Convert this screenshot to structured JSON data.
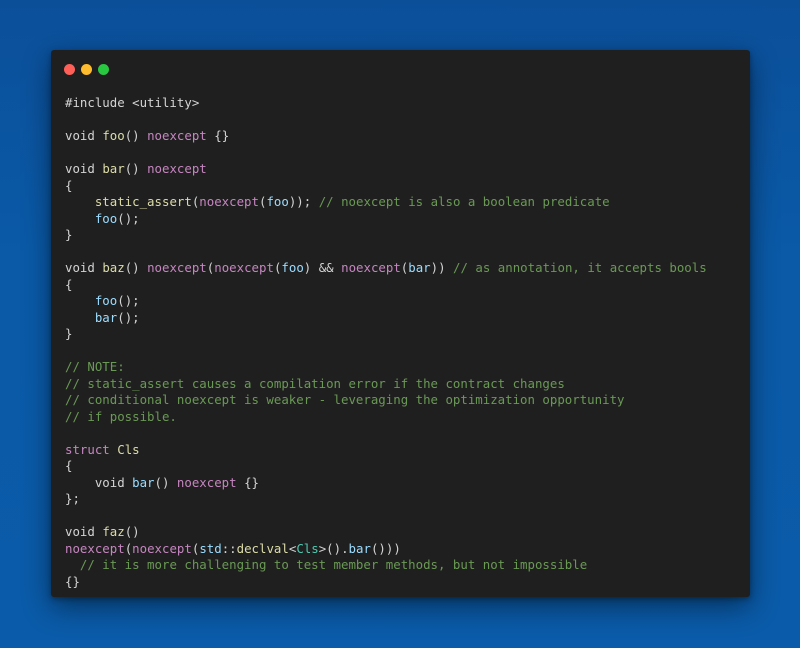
{
  "window": {
    "controls": [
      {
        "name": "close",
        "color": "#ff5f57"
      },
      {
        "name": "minimize",
        "color": "#febc2e"
      },
      {
        "name": "maximize",
        "color": "#28c840"
      }
    ]
  },
  "code_lines": [
    [
      {
        "t": "txt",
        "v": "#include <utility>"
      }
    ],
    [],
    [
      {
        "t": "txt",
        "v": "void "
      },
      {
        "t": "fn",
        "v": "foo"
      },
      {
        "t": "txt",
        "v": "() "
      },
      {
        "t": "kw",
        "v": "noexcept"
      },
      {
        "t": "txt",
        "v": " {}"
      }
    ],
    [],
    [
      {
        "t": "txt",
        "v": "void "
      },
      {
        "t": "fn",
        "v": "bar"
      },
      {
        "t": "txt",
        "v": "() "
      },
      {
        "t": "kw",
        "v": "noexcept"
      }
    ],
    [
      {
        "t": "txt",
        "v": "{"
      }
    ],
    [
      {
        "t": "txt",
        "v": "    "
      },
      {
        "t": "fn",
        "v": "static_assert"
      },
      {
        "t": "txt",
        "v": "("
      },
      {
        "t": "kw",
        "v": "noexcept"
      },
      {
        "t": "txt",
        "v": "("
      },
      {
        "t": "id",
        "v": "foo"
      },
      {
        "t": "txt",
        "v": ")); "
      },
      {
        "t": "cmt",
        "v": "// noexcept is also a boolean predicate"
      }
    ],
    [
      {
        "t": "txt",
        "v": "    "
      },
      {
        "t": "id",
        "v": "foo"
      },
      {
        "t": "txt",
        "v": "();"
      }
    ],
    [
      {
        "t": "txt",
        "v": "}"
      }
    ],
    [],
    [
      {
        "t": "txt",
        "v": "void "
      },
      {
        "t": "fn",
        "v": "baz"
      },
      {
        "t": "txt",
        "v": "() "
      },
      {
        "t": "kw",
        "v": "noexcept"
      },
      {
        "t": "txt",
        "v": "("
      },
      {
        "t": "kw",
        "v": "noexcept"
      },
      {
        "t": "txt",
        "v": "("
      },
      {
        "t": "id",
        "v": "foo"
      },
      {
        "t": "txt",
        "v": ") && "
      },
      {
        "t": "kw",
        "v": "noexcept"
      },
      {
        "t": "txt",
        "v": "("
      },
      {
        "t": "id",
        "v": "bar"
      },
      {
        "t": "txt",
        "v": ")) "
      },
      {
        "t": "cmt",
        "v": "// as annotation, it accepts bools"
      }
    ],
    [
      {
        "t": "txt",
        "v": "{"
      }
    ],
    [
      {
        "t": "txt",
        "v": "    "
      },
      {
        "t": "id",
        "v": "foo"
      },
      {
        "t": "txt",
        "v": "();"
      }
    ],
    [
      {
        "t": "txt",
        "v": "    "
      },
      {
        "t": "id",
        "v": "bar"
      },
      {
        "t": "txt",
        "v": "();"
      }
    ],
    [
      {
        "t": "txt",
        "v": "}"
      }
    ],
    [],
    [
      {
        "t": "cmt",
        "v": "// NOTE:"
      }
    ],
    [
      {
        "t": "cmt",
        "v": "// static_assert causes a compilation error if the contract changes"
      }
    ],
    [
      {
        "t": "cmt",
        "v": "// conditional noexcept is weaker - leveraging the optimization opportunity"
      }
    ],
    [
      {
        "t": "cmt",
        "v": "// if possible."
      }
    ],
    [],
    [
      {
        "t": "kw",
        "v": "struct"
      },
      {
        "t": "txt",
        "v": " "
      },
      {
        "t": "fn",
        "v": "Cls"
      }
    ],
    [
      {
        "t": "txt",
        "v": "{"
      }
    ],
    [
      {
        "t": "txt",
        "v": "    void "
      },
      {
        "t": "id",
        "v": "bar"
      },
      {
        "t": "txt",
        "v": "() "
      },
      {
        "t": "kw",
        "v": "noexcept"
      },
      {
        "t": "txt",
        "v": " {}"
      }
    ],
    [
      {
        "t": "txt",
        "v": "};"
      }
    ],
    [],
    [
      {
        "t": "txt",
        "v": "void "
      },
      {
        "t": "fn",
        "v": "faz"
      },
      {
        "t": "txt",
        "v": "()"
      }
    ],
    [
      {
        "t": "kw",
        "v": "noexcept"
      },
      {
        "t": "txt",
        "v": "("
      },
      {
        "t": "kw",
        "v": "noexcept"
      },
      {
        "t": "txt",
        "v": "("
      },
      {
        "t": "id",
        "v": "std"
      },
      {
        "t": "txt",
        "v": "::"
      },
      {
        "t": "fn",
        "v": "declval"
      },
      {
        "t": "txt",
        "v": "<"
      },
      {
        "t": "ty",
        "v": "Cls"
      },
      {
        "t": "txt",
        "v": ">()."
      },
      {
        "t": "id",
        "v": "bar"
      },
      {
        "t": "txt",
        "v": "()))"
      }
    ],
    [
      {
        "t": "txt",
        "v": "  "
      },
      {
        "t": "cmt",
        "v": "// it is more challenging to test member methods, but not impossible"
      }
    ],
    [
      {
        "t": "txt",
        "v": "{}"
      }
    ]
  ]
}
